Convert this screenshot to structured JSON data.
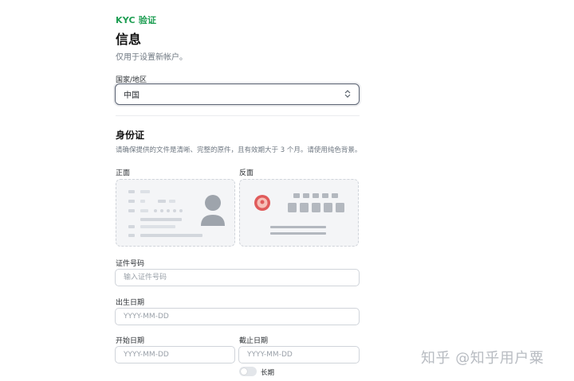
{
  "header": {
    "eyebrow": "KYC 验证",
    "title": "信息",
    "subtitle": "仅用于设置新帐户。"
  },
  "country": {
    "label": "国家/地区",
    "value": "中国",
    "icon": "chevron-up-down-icon"
  },
  "id_section": {
    "title": "身份证",
    "description": "请确保提供的文件是清晰、完整的原件，且有效期大于 3 个月。请使用纯色背景。",
    "front_label": "正面",
    "back_label": "反面",
    "front_icon": "id-card-front-icon",
    "back_icon": "id-card-back-emblem-icon"
  },
  "form": {
    "id_number_label": "证件号码",
    "id_number_placeholder": "输入证件号码",
    "birth_label": "出生日期",
    "birth_placeholder": "YYYY-MM-DD",
    "start_label": "开始日期",
    "start_placeholder": "YYYY-MM-DD",
    "end_label": "截止日期",
    "end_placeholder": "YYYY-MM-DD",
    "long_term_label": "长期",
    "long_term_on": false
  },
  "watermark": "知乎 @知乎用户粟",
  "colors": {
    "accent": "#1e9e53",
    "card_bg": "#f4f5f7",
    "emblem": "#e05b5b"
  }
}
